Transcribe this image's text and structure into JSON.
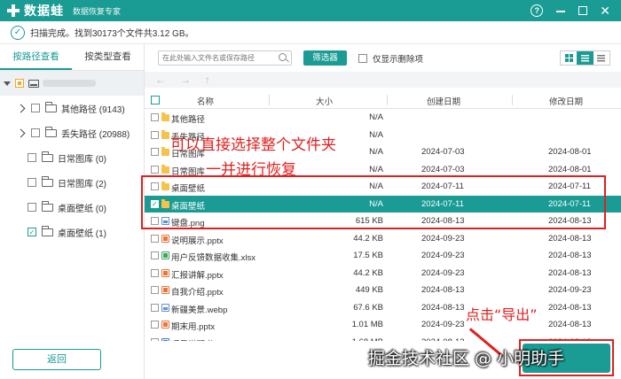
{
  "app": {
    "name": "数据蛙",
    "subtitle": "数据恢复专家"
  },
  "window_controls": {
    "help": "?",
    "close": "✕"
  },
  "status": {
    "text": "扫描完成。找到30173个文件共3.12 GB。",
    "check": "✓"
  },
  "left": {
    "tabs": [
      {
        "label": "按路径查看",
        "active": true
      },
      {
        "label": "按类型查看",
        "active": false
      }
    ],
    "tree": [
      {
        "label": "其他路径 (9143)",
        "expandable": true,
        "checked": false
      },
      {
        "label": "丢失路径 (20988)",
        "expandable": true,
        "checked": false
      },
      {
        "label": "日常图库 (0)",
        "expandable": false,
        "checked": false
      },
      {
        "label": "日常图库 (2)",
        "expandable": false,
        "checked": false
      },
      {
        "label": "桌面壁纸 (0)",
        "expandable": false,
        "checked": false
      },
      {
        "label": "桌面壁纸 (1)",
        "expandable": false,
        "checked": true
      }
    ],
    "back_button": "返回"
  },
  "toolbar": {
    "search_placeholder": "在此处输入文件名或保存路径",
    "filter_button": "筛选器",
    "only_deleted": "仅显示删除项"
  },
  "nav": {
    "back": "←",
    "forward": "→",
    "up": "↑"
  },
  "table": {
    "headers": {
      "name": "名称",
      "size": "大小",
      "created": "创建日期",
      "modified": "修改日期"
    },
    "rows": [
      {
        "name": "其他路径",
        "size": "N/A",
        "created": "",
        "modified": "",
        "type": "folder",
        "checked": false,
        "selected": false
      },
      {
        "name": "丢失路径",
        "size": "N/A",
        "created": "",
        "modified": "",
        "type": "folder",
        "checked": false,
        "selected": false
      },
      {
        "name": "日常图库",
        "size": "N/A",
        "created": "2024-07-03",
        "modified": "2024-08-01",
        "type": "folder",
        "checked": false,
        "selected": false
      },
      {
        "name": "日常图库",
        "size": "N/A",
        "created": "2024-07-03",
        "modified": "2024-08-01",
        "type": "folder",
        "checked": false,
        "selected": false
      },
      {
        "name": "桌面壁纸",
        "size": "N/A",
        "created": "2024-07-11",
        "modified": "2024-07-11",
        "type": "folder",
        "checked": false,
        "selected": false
      },
      {
        "name": "桌面壁纸",
        "size": "N/A",
        "created": "2024-07-11",
        "modified": "2024-07-11",
        "type": "folder",
        "checked": true,
        "selected": true
      },
      {
        "name": "键盘.png",
        "size": "615 KB",
        "created": "2024-08-13",
        "modified": "2024-08-13",
        "type": "img",
        "checked": false,
        "selected": false
      },
      {
        "name": "说明展示.pptx",
        "size": "44.2 KB",
        "created": "2024-09-23",
        "modified": "2024-08-13",
        "type": "pptx",
        "checked": false,
        "selected": false
      },
      {
        "name": "用户反馈数据收集.xlsx",
        "size": "17.5 KB",
        "created": "2024-09-23",
        "modified": "2024-08-13",
        "type": "xlsx",
        "checked": false,
        "selected": false
      },
      {
        "name": "汇报讲解.pptx",
        "size": "44.2 KB",
        "created": "2024-09-23",
        "modified": "2024-08-13",
        "type": "pptx",
        "checked": false,
        "selected": false
      },
      {
        "name": "自我介绍.pptx",
        "size": "449 KB",
        "created": "2024-08-13",
        "modified": "2024-09-23",
        "type": "pptx",
        "checked": false,
        "selected": false
      },
      {
        "name": "新疆美景.webp",
        "size": "67.6 KB",
        "created": "2024-08-13",
        "modified": "2024-08-13",
        "type": "img",
        "checked": false,
        "selected": false
      },
      {
        "name": "期末用.pptx",
        "size": "1.01 MB",
        "created": "2024-09-23",
        "modified": "2024-08-13",
        "type": "pptx",
        "checked": false,
        "selected": false
      },
      {
        "name": "项目说明书.docx",
        "size": "1.68 MB",
        "created": "2024-08-13",
        "modified": "2024-08-13",
        "type": "docx",
        "checked": false,
        "selected": false
      }
    ]
  },
  "annotations": {
    "line1": "可以直接选择整个文件夹",
    "line2": "一并进行恢复",
    "export_hint": "点击“导出”"
  },
  "export_button": "",
  "watermark": "掘金技术社区 @ 小明助手",
  "colors": {
    "accent": "#1a9b93",
    "annotation": "#e02020"
  }
}
